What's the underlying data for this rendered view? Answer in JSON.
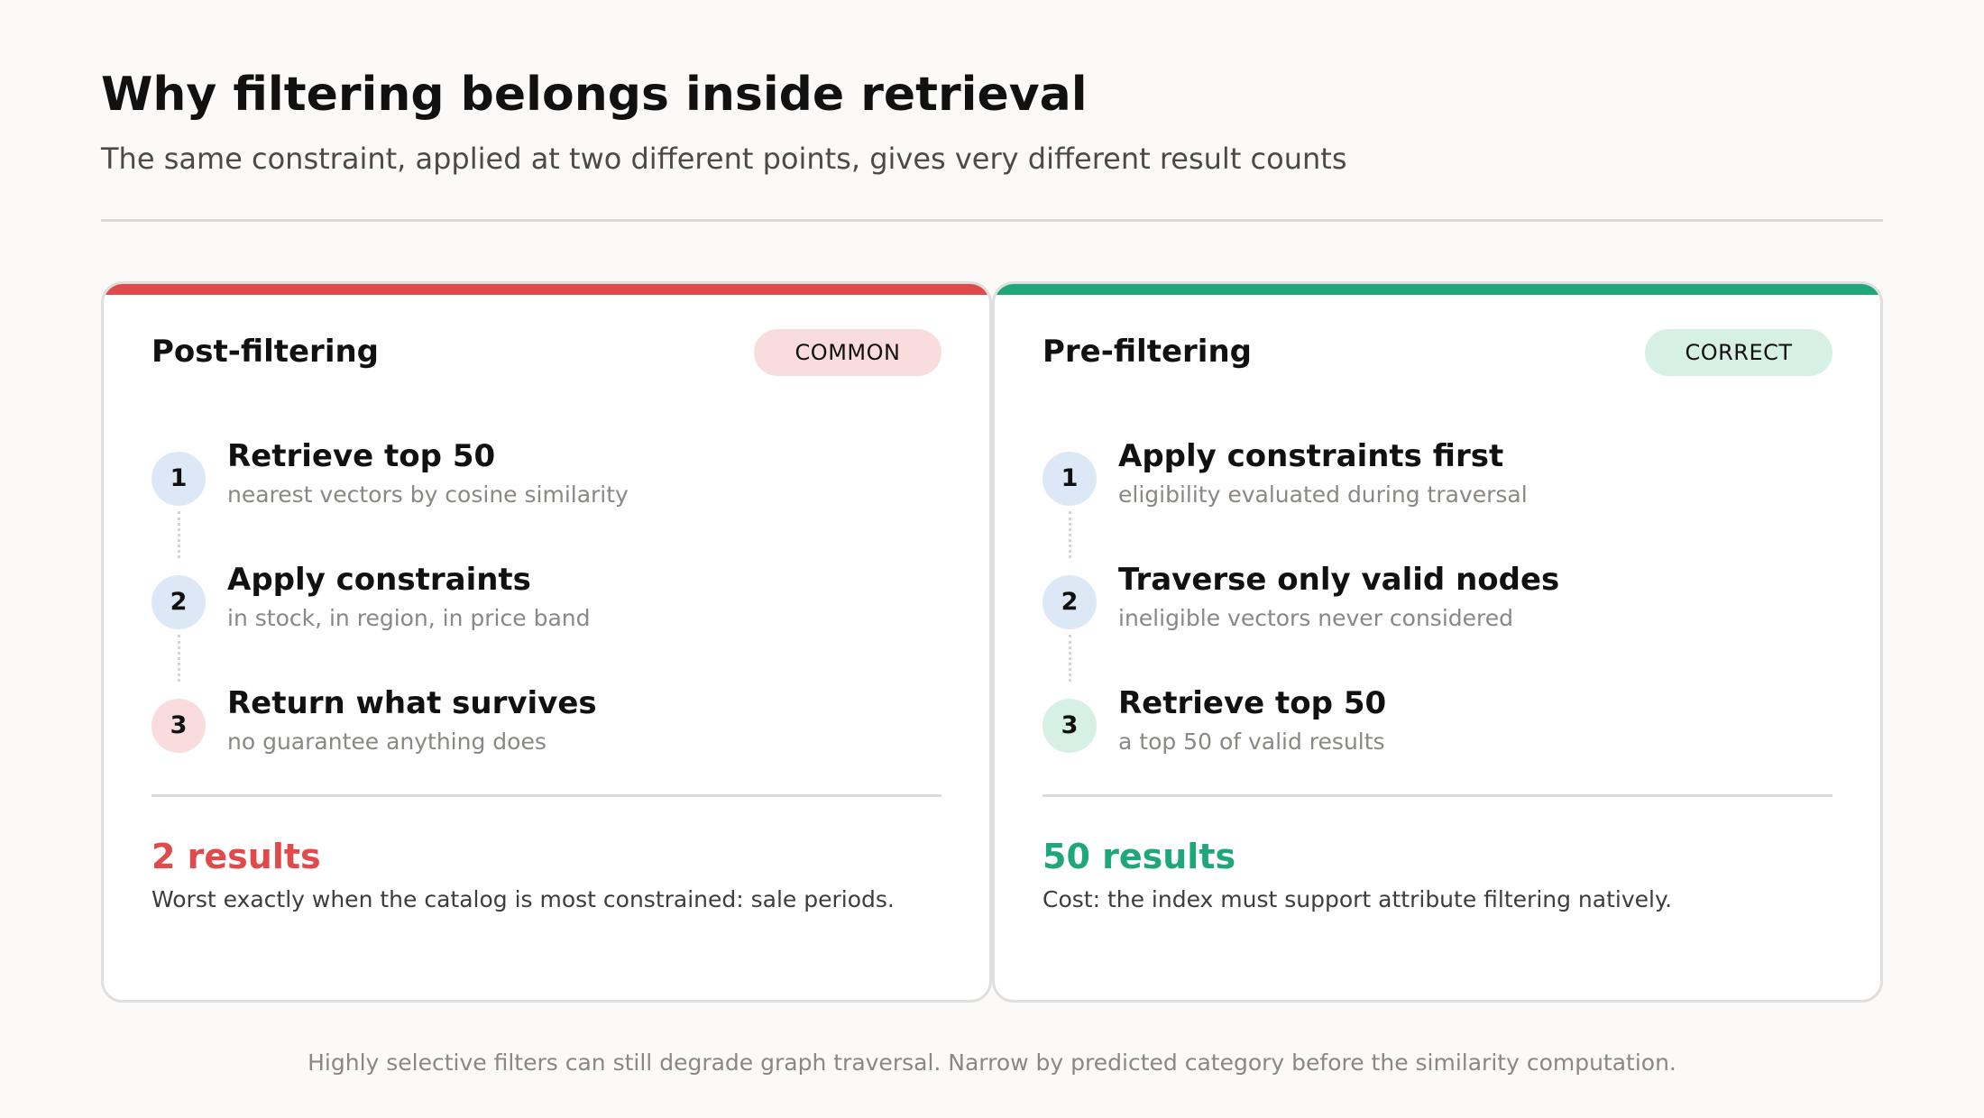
{
  "header": {
    "title": "Why filtering belongs inside retrieval",
    "subtitle": "The same constraint, applied at two different points, gives very different result counts"
  },
  "cards": [
    {
      "title": "Post-filtering",
      "badge": "COMMON",
      "accent_color": "#e04a4a",
      "badge_bg": "#f9dcdc",
      "steps": [
        {
          "num": "1",
          "title": "Retrieve top 50",
          "desc": "nearest vectors by cosine similarity",
          "circle_color": "#dde8f7"
        },
        {
          "num": "2",
          "title": "Apply constraints",
          "desc": "in stock, in region, in price band",
          "circle_color": "#dde8f7"
        },
        {
          "num": "3",
          "title": "Return what survives",
          "desc": "no guarantee anything does",
          "circle_color": "#f9dcdc"
        }
      ],
      "result": "2 results",
      "result_color": "#e04a4a",
      "note": "Worst exactly when the catalog is most constrained: sale periods."
    },
    {
      "title": "Pre-filtering",
      "badge": "CORRECT",
      "accent_color": "#1fa67a",
      "badge_bg": "#d6f0e5",
      "steps": [
        {
          "num": "1",
          "title": "Apply constraints first",
          "desc": "eligibility evaluated during traversal",
          "circle_color": "#dde8f7"
        },
        {
          "num": "2",
          "title": "Traverse only valid nodes",
          "desc": "ineligible vectors never considered",
          "circle_color": "#dde8f7"
        },
        {
          "num": "3",
          "title": "Retrieve top 50",
          "desc": "a top 50 of valid results",
          "circle_color": "#d6f0e5"
        }
      ],
      "result": "50 results",
      "result_color": "#1fa67a",
      "note": "Cost: the index must support attribute filtering natively."
    }
  ],
  "footer": "Highly selective filters can still degrade graph traversal. Narrow by predicted category before the similarity computation."
}
